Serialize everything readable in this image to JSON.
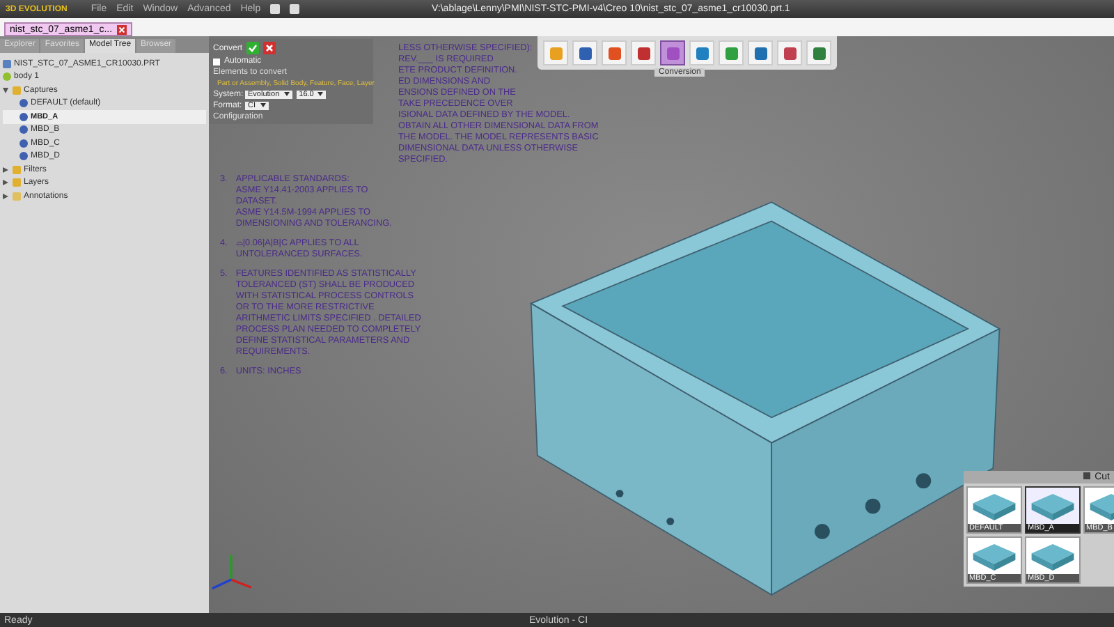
{
  "app": {
    "logo": "3D EVOLUTION",
    "menu": [
      "File",
      "Edit",
      "Window",
      "Advanced",
      "Help"
    ],
    "title": "V:\\ablage\\Lenny\\PMI\\NIST-STC-PMI-v4\\Creo 10\\nist_stc_07_asme1_cr10030.prt.1"
  },
  "doc_tabs": [
    {
      "label": "nist_stc_07_asme1_c...",
      "selected": true
    }
  ],
  "panel_tabs": [
    {
      "label": "Explorer",
      "selected": false
    },
    {
      "label": "Favorites",
      "selected": false
    },
    {
      "label": "Model Tree",
      "selected": true
    },
    {
      "label": "Browser",
      "selected": false
    }
  ],
  "tree": [
    {
      "label": "NIST_STC_07_ASME1_CR10030.PRT",
      "kind": "part",
      "selected": false
    },
    {
      "label": "body 1",
      "kind": "body",
      "selected": false
    },
    {
      "label": "Captures",
      "kind": "folder",
      "selected": false,
      "expanded": true,
      "children": [
        {
          "label": "DEFAULT (default)",
          "kind": "capture",
          "selected": false
        },
        {
          "label": "MBD_A",
          "kind": "capture",
          "selected": true
        },
        {
          "label": "MBD_B",
          "kind": "capture",
          "selected": false
        },
        {
          "label": "MBD_C",
          "kind": "capture",
          "selected": false
        },
        {
          "label": "MBD_D",
          "kind": "capture",
          "selected": false
        }
      ]
    },
    {
      "label": "Filters",
      "kind": "folder",
      "selected": false,
      "expanded": false
    },
    {
      "label": "Layers",
      "kind": "folder",
      "selected": false,
      "expanded": false
    },
    {
      "label": "Annotations",
      "kind": "annotation",
      "selected": false,
      "expanded": false
    }
  ],
  "convert_panel": {
    "title": "Convert",
    "automatic": {
      "label": "Automatic",
      "checked": false
    },
    "elements_label": "Elements to convert",
    "hint": "Part or Assembly, Solid Body, Feature, Face, Layer",
    "system_label": "System:",
    "system": "Evolution",
    "version": "16.0",
    "format_label": "Format:",
    "format": "CI",
    "configuration": "Configuration"
  },
  "toolbar": {
    "tools": [
      {
        "selected": false
      },
      {
        "selected": false
      },
      {
        "selected": false
      },
      {
        "selected": false
      },
      {
        "selected": true
      },
      {
        "selected": false
      },
      {
        "selected": false
      },
      {
        "selected": false
      },
      {
        "selected": false
      },
      {
        "selected": false
      }
    ],
    "tooltip": "Conversion"
  },
  "notes_partial": [
    "LESS OTHERWISE SPECIFIED):",
    "REV.___ IS REQUIRED",
    "ETE PRODUCT DEFINITION.",
    "ED DIMENSIONS AND",
    "ENSIONS DEFINED ON THE",
    "TAKE PRECEDENCE OVER",
    "ISIONAL DATA DEFINED BY THE MODEL.",
    "OBTAIN ALL OTHER DIMENSIONAL DATA FROM",
    "THE MODEL. THE MODEL REPRESENTS BASIC",
    "DIMENSIONAL DATA UNLESS OTHERWISE",
    "SPECIFIED."
  ],
  "notes": [
    {
      "number": "3.",
      "text": "APPLICABLE STANDARDS:\nASME Y14.41-2003 APPLIES TO\nDATASET.\nASME Y14.5M-1994 APPLIES TO\nDIMENSIONING AND TOLERANCING."
    },
    {
      "number": "4.",
      "text": "⌓|0.06|A|B|C APPLIES TO ALL\nUNTOLERANCED SURFACES."
    },
    {
      "number": "5.",
      "text": "FEATURES IDENTIFIED AS STATISTICALLY\nTOLERANCED (ST) SHALL BE PRODUCED\nWITH STATISTICAL PROCESS CONTROLS\nOR TO THE MORE RESTRICTIVE\nARITHMETIC LIMITS SPECIFIED . DETAILED\nPROCESS PLAN NEEDED TO COMPLETELY\nDEFINE STATISTICAL PARAMETERS AND\nREQUIREMENTS."
    },
    {
      "number": "6.",
      "text": "UNITS: INCHES"
    }
  ],
  "captures": {
    "header": "Cut",
    "items": [
      {
        "label": "DEFAULT",
        "selected": false
      },
      {
        "label": "MBD_A",
        "selected": true
      },
      {
        "label": "MBD_B",
        "selected": false
      },
      {
        "label": "MBD_C",
        "selected": false
      },
      {
        "label": "MBD_D",
        "selected": false
      }
    ]
  },
  "status": {
    "left": "Ready",
    "center": "Evolution - CI"
  }
}
